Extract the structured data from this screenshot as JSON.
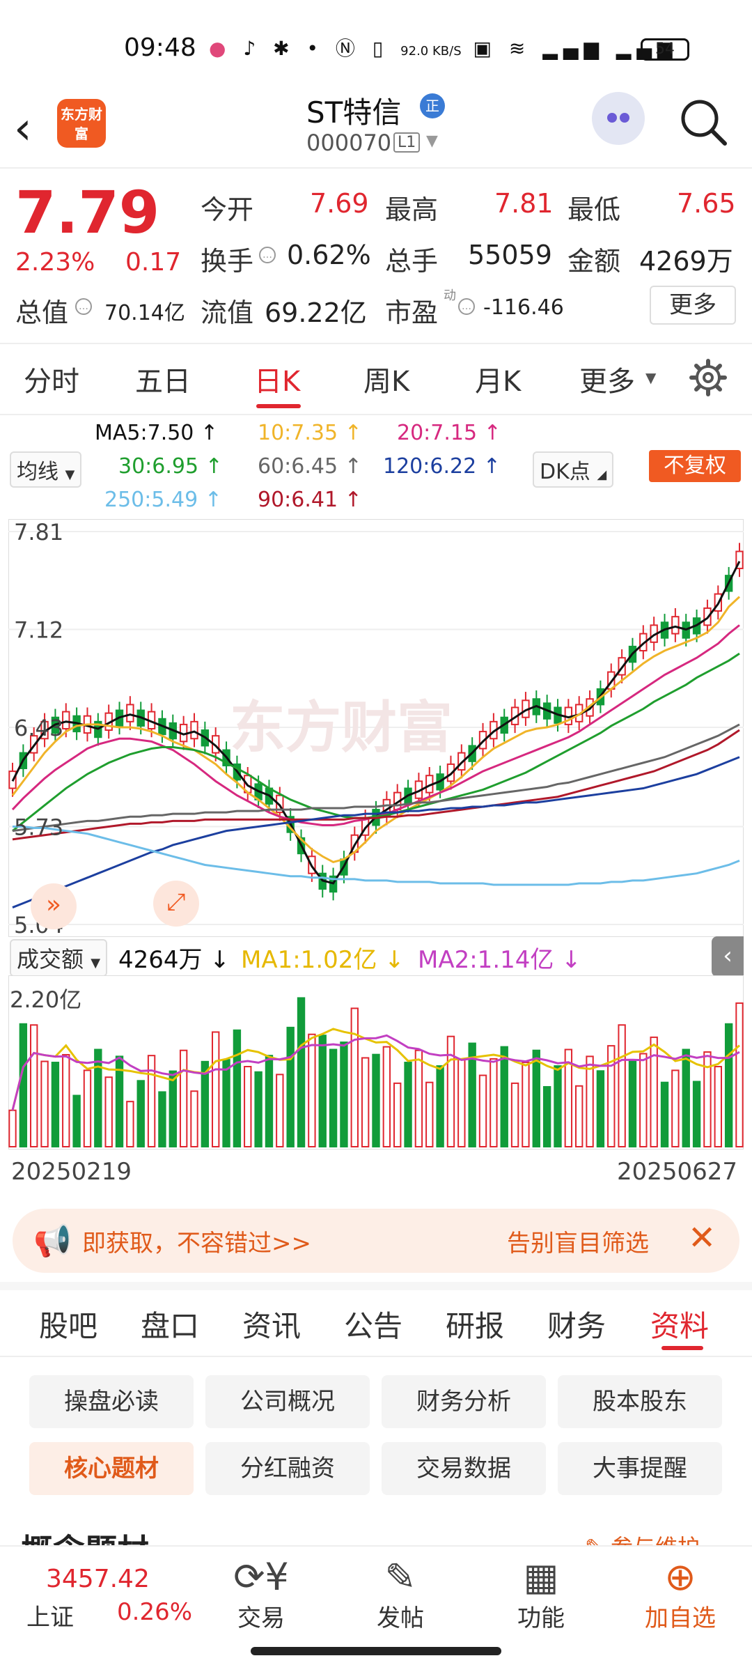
{
  "status_bar": {
    "time": "09:48",
    "net_speed": "92.0 KB/S",
    "battery": "54"
  },
  "header": {
    "logo_text": "东方财富",
    "stock_name": "ST特信",
    "badge": "正",
    "stock_code": "000070",
    "level": "L1"
  },
  "quote": {
    "price": "7.79",
    "pct_change": "2.23%",
    "change": "0.17",
    "open_label": "今开",
    "open": "7.69",
    "high_label": "最高",
    "high": "7.81",
    "low_label": "最低",
    "low": "7.65",
    "turnover_label": "换手",
    "turnover": "0.62%",
    "volume_label": "总手",
    "volume": "55059",
    "amount_label": "金额",
    "amount": "4269万",
    "mcap_label": "总值",
    "mcap": "70.14亿",
    "float_label": "流值",
    "float_cap": "69.22亿",
    "pe_label": "市盈",
    "pe_sup": "动",
    "pe": "-116.46",
    "more_label": "更多"
  },
  "period_tabs": [
    "分时",
    "五日",
    "日K",
    "周K",
    "月K",
    "更多"
  ],
  "active_period": "日K",
  "ma_legend": {
    "ma_select": "均线",
    "ma5": "MA5:7.50 ↑",
    "ma10": "10:7.35 ↑",
    "ma20": "20:7.15 ↑",
    "ma30": "30:6.95 ↑",
    "ma60": "60:6.45 ↑",
    "ma120": "120:6.22 ↑",
    "ma250": "250:5.49 ↑",
    "ma90": "90:6.41 ↑",
    "dk_select": "DK点",
    "adjust": "不复权"
  },
  "colors": {
    "up": "#e0262f",
    "down": "#119c3a",
    "ma5": "#111111",
    "ma10": "#f0b429",
    "ma20": "#d6287f",
    "ma30": "#1f9e2e",
    "ma60": "#666666",
    "ma120": "#1c3f9f",
    "ma250": "#6cbde8",
    "ma90": "#b0182a"
  },
  "chart_data": [
    {
      "type": "candlestick",
      "y_ticks": [
        "7.81",
        "7.12",
        "6.43",
        "5.73",
        "5.04"
      ],
      "ylim": [
        5.04,
        7.81
      ],
      "x_start_label": "20250219",
      "x_end_label": "20250627",
      "series": [
        {
          "name": "MA5",
          "values": [
            6.05,
            6.2,
            6.3,
            6.4,
            6.45,
            6.47,
            6.46,
            6.44,
            6.42,
            6.46,
            6.5,
            6.52,
            6.5,
            6.47,
            6.44,
            6.41,
            6.38,
            6.4,
            6.36,
            6.3,
            6.22,
            6.12,
            6.02,
            5.98,
            5.95,
            5.88,
            5.75,
            5.6,
            5.45,
            5.35,
            5.33,
            5.45,
            5.6,
            5.72,
            5.8,
            5.85,
            5.9,
            5.95,
            5.98,
            6.02,
            6.05,
            6.1,
            6.18,
            6.25,
            6.33,
            6.4,
            6.45,
            6.5,
            6.55,
            6.58,
            6.55,
            6.52,
            6.5,
            6.52,
            6.56,
            6.65,
            6.75,
            6.85,
            6.95,
            7.02,
            7.08,
            7.12,
            7.14,
            7.12,
            7.15,
            7.2,
            7.3,
            7.45,
            7.6
          ]
        },
        {
          "name": "MA10",
          "values": [
            5.95,
            6.05,
            6.15,
            6.25,
            6.33,
            6.4,
            6.44,
            6.45,
            6.45,
            6.44,
            6.43,
            6.43,
            6.42,
            6.4,
            6.37,
            6.33,
            6.3,
            6.27,
            6.22,
            6.17,
            6.1,
            6.04,
            5.97,
            5.92,
            5.86,
            5.8,
            5.72,
            5.64,
            5.57,
            5.52,
            5.48,
            5.5,
            5.55,
            5.62,
            5.7,
            5.75,
            5.8,
            5.85,
            5.89,
            5.93,
            5.97,
            6.02,
            6.08,
            6.15,
            6.22,
            6.28,
            6.32,
            6.36,
            6.4,
            6.42,
            6.43,
            6.45,
            6.48,
            6.52,
            6.58,
            6.64,
            6.7,
            6.76,
            6.82,
            6.88,
            6.93,
            6.97,
            7.0,
            7.03,
            7.06,
            7.1,
            7.17,
            7.28,
            7.35
          ]
        },
        {
          "name": "MA20",
          "values": [
            5.85,
            5.93,
            6.0,
            6.07,
            6.13,
            6.18,
            6.23,
            6.28,
            6.31,
            6.33,
            6.35,
            6.35,
            6.34,
            6.33,
            6.3,
            6.27,
            6.22,
            6.17,
            6.11,
            6.05,
            6.0,
            5.95,
            5.91,
            5.87,
            5.83,
            5.8,
            5.78,
            5.76,
            5.75,
            5.74,
            5.74,
            5.75,
            5.77,
            5.78,
            5.8,
            5.82,
            5.85,
            5.88,
            5.91,
            5.94,
            5.97,
            6.0,
            6.04,
            6.08,
            6.12,
            6.15,
            6.18,
            6.21,
            6.24,
            6.27,
            6.3,
            6.33,
            6.36,
            6.4,
            6.45,
            6.5,
            6.55,
            6.6,
            6.65,
            6.7,
            6.75,
            6.8,
            6.84,
            6.88,
            6.92,
            6.97,
            7.02,
            7.09,
            7.15
          ]
        },
        {
          "name": "MA30",
          "values": [
            5.7,
            5.76,
            5.82,
            5.88,
            5.94,
            6.0,
            6.05,
            6.1,
            6.14,
            6.18,
            6.21,
            6.24,
            6.26,
            6.28,
            6.29,
            6.29,
            6.28,
            6.27,
            6.25,
            6.22,
            6.18,
            6.14,
            6.1,
            6.05,
            6.0,
            5.96,
            5.92,
            5.89,
            5.86,
            5.84,
            5.82,
            5.8,
            5.79,
            5.79,
            5.8,
            5.81,
            5.83,
            5.85,
            5.87,
            5.89,
            5.91,
            5.93,
            5.95,
            5.97,
            5.99,
            6.02,
            6.05,
            6.08,
            6.11,
            6.15,
            6.19,
            6.23,
            6.27,
            6.31,
            6.35,
            6.39,
            6.44,
            6.48,
            6.52,
            6.56,
            6.61,
            6.65,
            6.69,
            6.73,
            6.78,
            6.82,
            6.86,
            6.9,
            6.95
          ]
        },
        {
          "name": "MA60",
          "values": [
            5.7,
            5.71,
            5.72,
            5.73,
            5.74,
            5.75,
            5.76,
            5.77,
            5.77,
            5.78,
            5.79,
            5.8,
            5.8,
            5.81,
            5.81,
            5.82,
            5.82,
            5.82,
            5.83,
            5.83,
            5.83,
            5.84,
            5.84,
            5.84,
            5.85,
            5.85,
            5.85,
            5.85,
            5.86,
            5.86,
            5.86,
            5.86,
            5.87,
            5.87,
            5.87,
            5.88,
            5.88,
            5.89,
            5.9,
            5.9,
            5.91,
            5.92,
            5.93,
            5.94,
            5.95,
            5.96,
            5.97,
            5.98,
            5.99,
            6.0,
            6.01,
            6.03,
            6.04,
            6.06,
            6.08,
            6.1,
            6.12,
            6.14,
            6.16,
            6.18,
            6.2,
            6.22,
            6.25,
            6.28,
            6.31,
            6.34,
            6.37,
            6.41,
            6.45
          ]
        },
        {
          "name": "MA90",
          "values": [
            5.64,
            5.65,
            5.66,
            5.67,
            5.68,
            5.69,
            5.7,
            5.71,
            5.72,
            5.73,
            5.74,
            5.75,
            5.75,
            5.76,
            5.76,
            5.77,
            5.77,
            5.77,
            5.78,
            5.78,
            5.78,
            5.78,
            5.78,
            5.78,
            5.78,
            5.78,
            5.78,
            5.78,
            5.78,
            5.78,
            5.78,
            5.78,
            5.79,
            5.79,
            5.79,
            5.8,
            5.8,
            5.81,
            5.81,
            5.82,
            5.83,
            5.84,
            5.85,
            5.86,
            5.87,
            5.88,
            5.89,
            5.9,
            5.91,
            5.92,
            5.93,
            5.94,
            5.96,
            5.98,
            6.0,
            6.02,
            6.04,
            6.06,
            6.08,
            6.1,
            6.12,
            6.15,
            6.18,
            6.21,
            6.24,
            6.27,
            6.31,
            6.36,
            6.41
          ]
        },
        {
          "name": "MA120",
          "values": [
            5.16,
            5.19,
            5.22,
            5.25,
            5.28,
            5.31,
            5.34,
            5.37,
            5.4,
            5.43,
            5.46,
            5.49,
            5.52,
            5.55,
            5.57,
            5.6,
            5.62,
            5.64,
            5.66,
            5.68,
            5.7,
            5.71,
            5.72,
            5.73,
            5.74,
            5.75,
            5.76,
            5.77,
            5.78,
            5.79,
            5.8,
            5.81,
            5.81,
            5.82,
            5.82,
            5.83,
            5.83,
            5.84,
            5.84,
            5.85,
            5.85,
            5.86,
            5.86,
            5.87,
            5.87,
            5.88,
            5.88,
            5.89,
            5.9,
            5.9,
            5.91,
            5.92,
            5.93,
            5.94,
            5.95,
            5.96,
            5.97,
            5.98,
            5.99,
            6.0,
            6.02,
            6.04,
            6.06,
            6.08,
            6.1,
            6.13,
            6.16,
            6.19,
            6.22
          ]
        },
        {
          "name": "MA250",
          "values": [
            5.73,
            5.73,
            5.72,
            5.72,
            5.71,
            5.7,
            5.69,
            5.68,
            5.66,
            5.64,
            5.62,
            5.6,
            5.58,
            5.56,
            5.54,
            5.52,
            5.5,
            5.48,
            5.46,
            5.45,
            5.44,
            5.43,
            5.42,
            5.41,
            5.4,
            5.39,
            5.38,
            5.38,
            5.37,
            5.37,
            5.36,
            5.36,
            5.36,
            5.35,
            5.35,
            5.35,
            5.34,
            5.34,
            5.34,
            5.34,
            5.33,
            5.33,
            5.33,
            5.33,
            5.33,
            5.32,
            5.32,
            5.32,
            5.32,
            5.32,
            5.32,
            5.32,
            5.32,
            5.33,
            5.33,
            5.33,
            5.34,
            5.34,
            5.35,
            5.35,
            5.36,
            5.37,
            5.38,
            5.39,
            5.4,
            5.42,
            5.44,
            5.46,
            5.49
          ]
        }
      ]
    },
    {
      "type": "bar",
      "name": "成交额",
      "current": "4264万 ↓",
      "ma1": "MA1:1.02亿 ↓",
      "ma2": "MA2:1.14亿 ↓",
      "y_top_label": "2.20亿",
      "ylim": [
        0,
        2.2
      ]
    }
  ],
  "banner": {
    "left_text": "即获取，不容错过>>",
    "right_text": "告别盲目筛选"
  },
  "section_tabs": [
    "股吧",
    "盘口",
    "资讯",
    "公告",
    "研报",
    "财务",
    "资料"
  ],
  "active_section": "资料",
  "grid_buttons": [
    "操盘必读",
    "公司概况",
    "财务分析",
    "股本股东",
    "核心题材",
    "分红融资",
    "交易数据",
    "大事提醒"
  ],
  "active_grid": "核心题材",
  "concept": {
    "title": "概念题材",
    "right": "参与维护"
  },
  "bottom_bar": {
    "index_value": "3457.42",
    "index_name": "上证",
    "index_pct": "0.26%",
    "items": [
      {
        "label": "交易",
        "icon": "trade-icon"
      },
      {
        "label": "发帖",
        "icon": "post-icon"
      },
      {
        "label": "功能",
        "icon": "apps-icon"
      },
      {
        "label": "加自选",
        "icon": "add-favorite-icon"
      }
    ]
  }
}
